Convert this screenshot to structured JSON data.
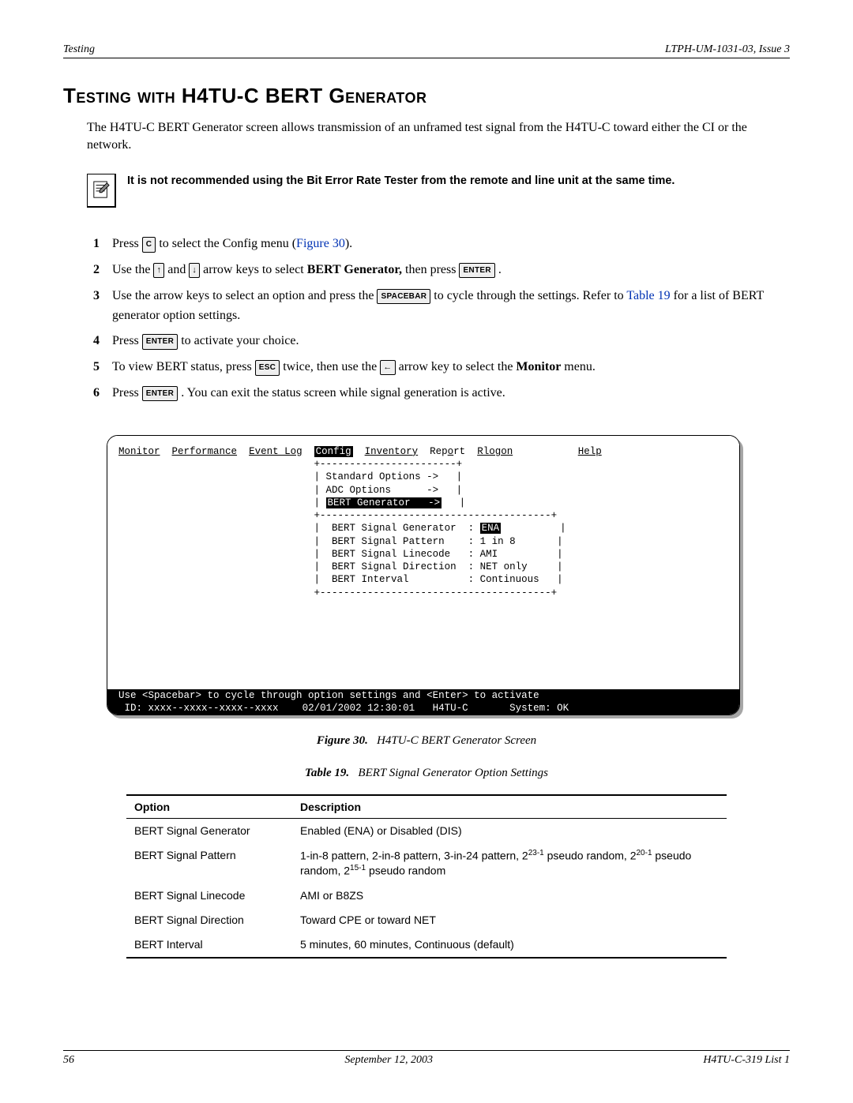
{
  "top_header": {
    "left": "Testing",
    "right": "LTPH-UM-1031-03, Issue 3"
  },
  "title": "Testing with H4TU-C BERT Generator",
  "intro": "The H4TU-C BERT Generator screen allows transmission of an unframed test signal from the H4TU-C toward either the CI or the network.",
  "note": "It is not recommended using the Bit Error Rate Tester from the remote and line unit at the same time.",
  "steps": {
    "s1": {
      "pre": "Press ",
      "key": "C",
      "mid": " to select the Config menu (",
      "fig": "Figure 30",
      "post": ")."
    },
    "s2": {
      "pre": "Use the ",
      "up": "↑",
      "and": " and ",
      "down": "↓",
      "mid": " arrow keys to select ",
      "bold": "BERT Generator,",
      "then": " then press ",
      "enter": "ENTER",
      "end": " ."
    },
    "s3": {
      "pre": "Use the arrow keys to select an option and press the ",
      "spacebar": "SPACEBAR",
      "mid": " to cycle through the settings. Refer to ",
      "link": "Table 19",
      "post": " for a list of BERT generator option settings."
    },
    "s4": {
      "pre": "Press ",
      "enter": "ENTER",
      "post": " to activate your choice."
    },
    "s5": {
      "pre": "To view BERT status, press ",
      "esc": "ESC",
      "mid": " twice, then use the ",
      "left": "←",
      "mid2": " arrow key to select the ",
      "bold": "Monitor",
      "post": " menu."
    },
    "s6": {
      "pre": "Press ",
      "enter": "ENTER",
      "post": " . You can exit the status screen while signal generation is active."
    }
  },
  "terminal": {
    "menu": [
      "Monitor",
      "Performance",
      "Event Log",
      "Config",
      "Inventory",
      "Report",
      "Rlogon",
      "Help"
    ],
    "dropdown": {
      "line1": "Standard Options ->",
      "line2": "ADC Options      ->",
      "line3": "BERT Generator   ->"
    },
    "options": {
      "o1l": "BERT Signal Generator",
      "o1v": "ENA",
      "o2l": "BERT Signal Pattern",
      "o2v": "1 in 8",
      "o3l": "BERT Signal Linecode",
      "o3v": "AMI",
      "o4l": "BERT Signal Direction",
      "o4v": "NET only",
      "o5l": "BERT Interval",
      "o5v": "Continuous"
    },
    "hint": "Use <Spacebar> to cycle through option settings and <Enter> to activate",
    "status": {
      "id": " ID: xxxx--xxxx--xxxx--xxxx",
      "dt": "02/01/2002 12:30:01",
      "unit": "H4TU-C",
      "sys": "System: OK "
    }
  },
  "fig_caption": {
    "label": "Figure 30.",
    "text": "H4TU-C BERT Generator Screen"
  },
  "table_caption": {
    "label": "Table 19.",
    "text": "BERT Signal Generator Option Settings"
  },
  "table": {
    "headers": [
      "Option",
      "Description"
    ],
    "rows": [
      {
        "opt": "BERT Signal Generator",
        "desc": "Enabled (ENA) or Disabled (DIS)"
      },
      {
        "opt": "BERT Signal Pattern",
        "desc_raw": true
      },
      {
        "opt": "BERT Signal Linecode",
        "desc": "AMI or B8ZS"
      },
      {
        "opt": "BERT Signal Direction",
        "desc": "Toward CPE or toward NET"
      },
      {
        "opt": "BERT Interval",
        "desc": "5 minutes, 60 minutes, Continuous (default)"
      }
    ],
    "pattern_desc_parts": {
      "p1": "1-in-8 pattern, 2-in-8 pattern, 3-in-24 pattern, 2",
      "e1": "23-1",
      "p2": " pseudo random, 2",
      "e2": "20-1",
      "p3": " pseudo random, 2",
      "e3": "15-1",
      "p4": " pseudo random"
    }
  },
  "footer": {
    "left": "56",
    "center": "September 12, 2003",
    "right": "H4TU-C-319 List 1"
  }
}
